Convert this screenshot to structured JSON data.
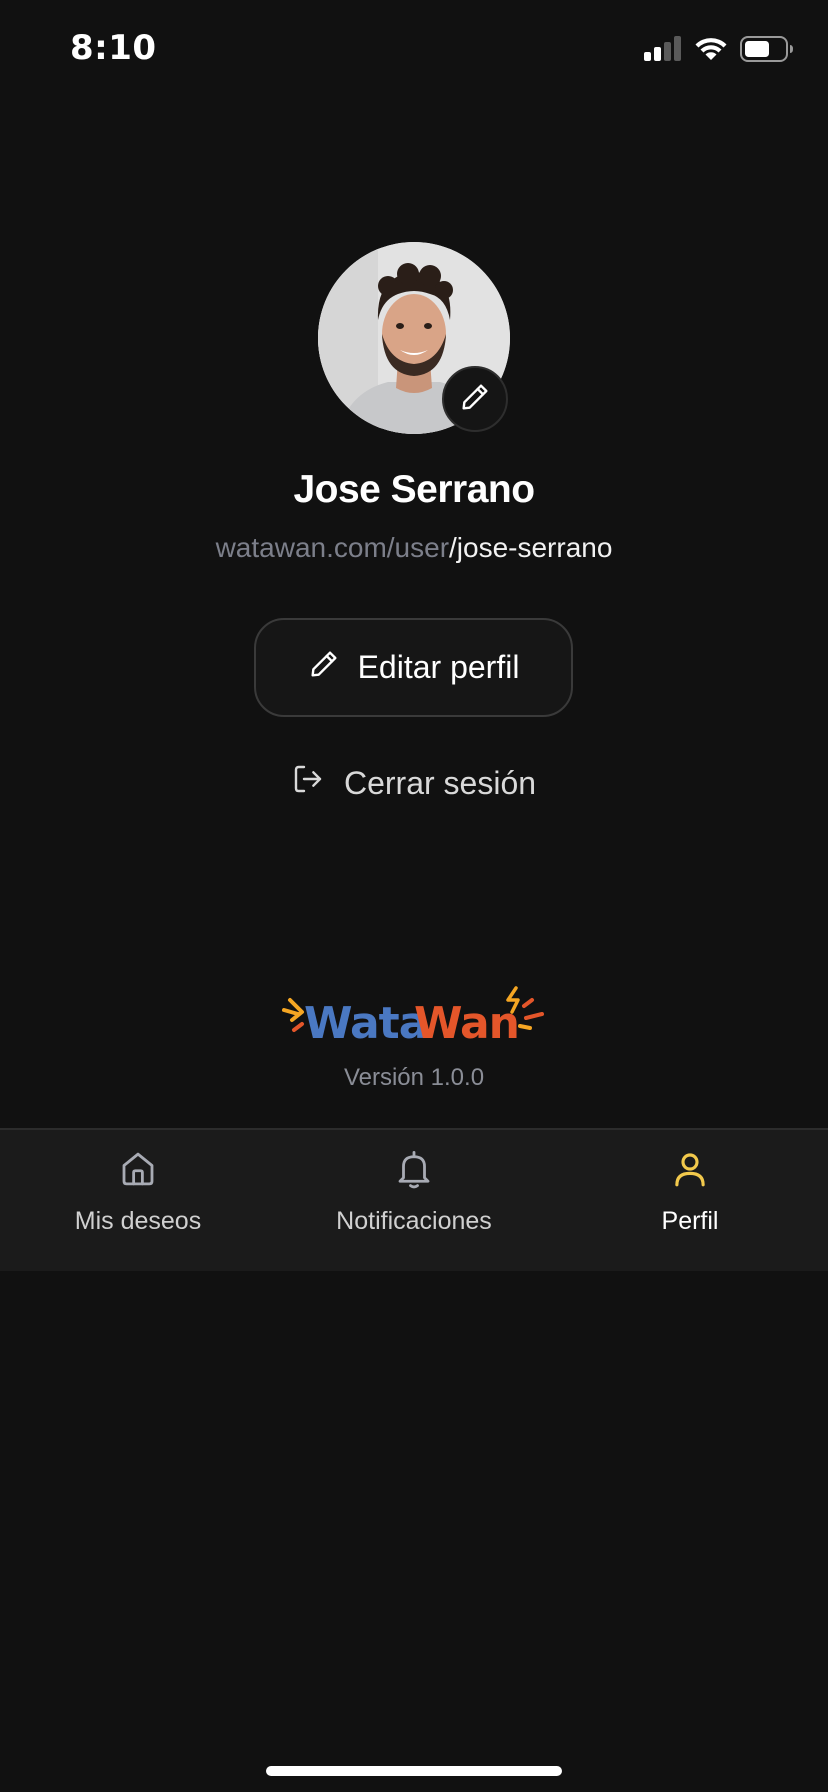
{
  "status_bar": {
    "time": "8:10",
    "icons": [
      "cellular-signal-icon",
      "wifi-icon",
      "battery-icon"
    ]
  },
  "profile": {
    "name": "Jose Serrano",
    "url_prefix": "watawan.com/user",
    "url_slug": "/jose-serrano",
    "avatar_edit_icon": "pencil-icon"
  },
  "actions": {
    "edit_profile_label": "Editar perfil",
    "logout_label": "Cerrar sesión"
  },
  "brand": {
    "logo_text": "WataWan",
    "version": "Versión 1.0.0",
    "colors": {
      "wata": "#4a78c2",
      "wan": "#e4562a",
      "spark": "#f5a623"
    }
  },
  "tabbar": {
    "tabs": [
      {
        "label": "Mis deseos",
        "icon": "home-icon",
        "active": false
      },
      {
        "label": "Notificaciones",
        "icon": "bell-icon",
        "active": false
      },
      {
        "label": "Perfil",
        "icon": "user-icon",
        "active": true
      }
    ],
    "active_color": "#f2c94c"
  }
}
